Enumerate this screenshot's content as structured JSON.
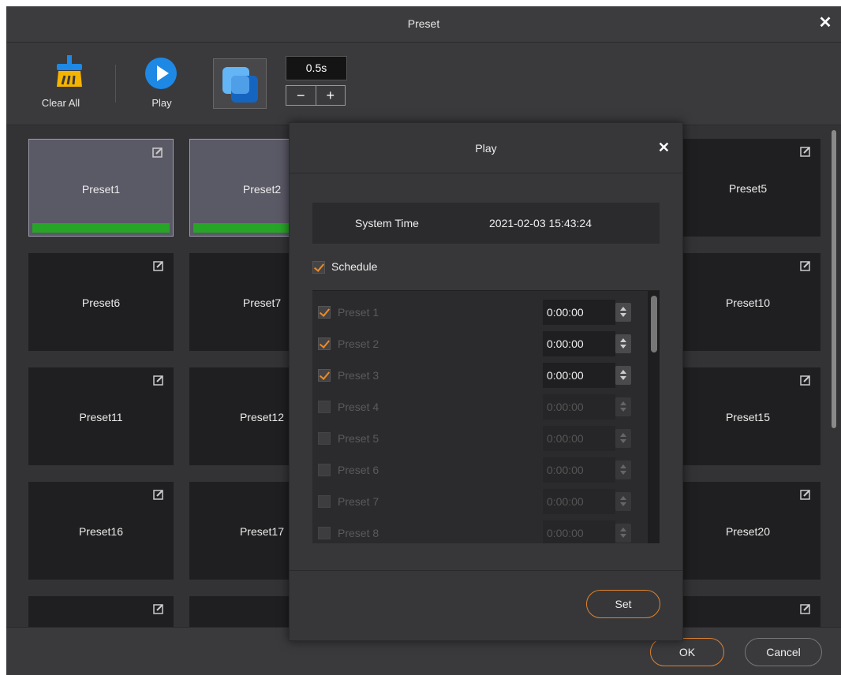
{
  "window": {
    "title": "Preset",
    "close": "✕"
  },
  "toolbar": {
    "clear_all": "Clear All",
    "play": "Play",
    "interval": "0.5s",
    "minus": "−",
    "plus": "+"
  },
  "tiles": [
    {
      "name": "Preset1",
      "selected": true
    },
    {
      "name": "Preset2",
      "selected": true
    },
    {
      "name": "Preset5"
    },
    {
      "name": "Preset6"
    },
    {
      "name": "Preset7"
    },
    {
      "name": "Preset10"
    },
    {
      "name": "Preset11"
    },
    {
      "name": "Preset12"
    },
    {
      "name": "Preset15"
    },
    {
      "name": "Preset16"
    },
    {
      "name": "Preset17"
    },
    {
      "name": "Preset20"
    }
  ],
  "footer": {
    "ok": "OK",
    "cancel": "Cancel"
  },
  "play_dialog": {
    "title": "Play",
    "close": "✕",
    "system_time_label": "System Time",
    "system_time_value": "2021-02-03 15:43:24",
    "schedule_label": "Schedule",
    "schedule_checked": true,
    "rows": [
      {
        "name": "Preset 1",
        "time": "0:00:00",
        "checked": true
      },
      {
        "name": "Preset 2",
        "time": "0:00:00",
        "checked": true
      },
      {
        "name": "Preset 3",
        "time": "0:00:00",
        "checked": true
      },
      {
        "name": "Preset 4",
        "time": "0:00:00",
        "checked": false
      },
      {
        "name": "Preset 5",
        "time": "0:00:00",
        "checked": false
      },
      {
        "name": "Preset 6",
        "time": "0:00:00",
        "checked": false
      },
      {
        "name": "Preset 7",
        "time": "0:00:00",
        "checked": false
      },
      {
        "name": "Preset 8",
        "time": "0:00:00",
        "checked": false
      }
    ],
    "set": "Set"
  },
  "colors": {
    "accent": "#e0822e",
    "progress": "#27a527",
    "play_blue": "#1e88e5",
    "broom_yellow": "#f5b400"
  }
}
